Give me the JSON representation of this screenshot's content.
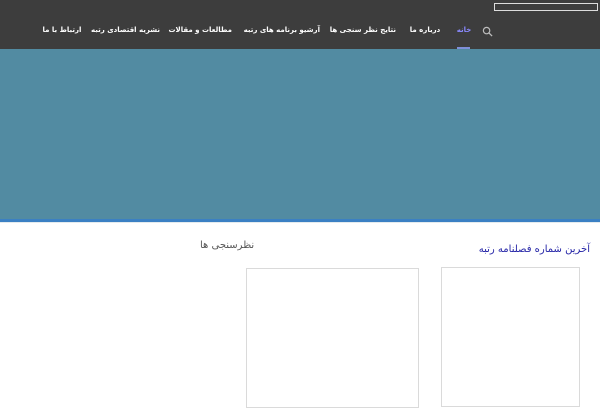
{
  "header": {
    "search": {
      "placeholder": "",
      "value": ""
    },
    "search_icon": "search-icon"
  },
  "nav": {
    "items": [
      {
        "label": "خانه",
        "active": true
      },
      {
        "label": "درباره ما",
        "active": false
      },
      {
        "label": "نتایج نظر سنجی ها",
        "active": false
      },
      {
        "label": "آرشیو برنامه های رتبه",
        "active": false
      },
      {
        "label": "مطالعات و مقالات",
        "active": false
      },
      {
        "label": "نشریه اقتصادی رتبه",
        "active": false
      },
      {
        "label": "ارتباط با ما",
        "active": false
      }
    ]
  },
  "colors": {
    "topbar": "#3d3d3d",
    "hero": "#528ba2",
    "accent_line": "#3b80c3",
    "active_nav": "#8a8aff",
    "link": "#2222a6"
  },
  "sections": {
    "polls_title": "نظرسنجی ها",
    "magazine_title": "آخرین شماره فصلنامه رتبه"
  }
}
